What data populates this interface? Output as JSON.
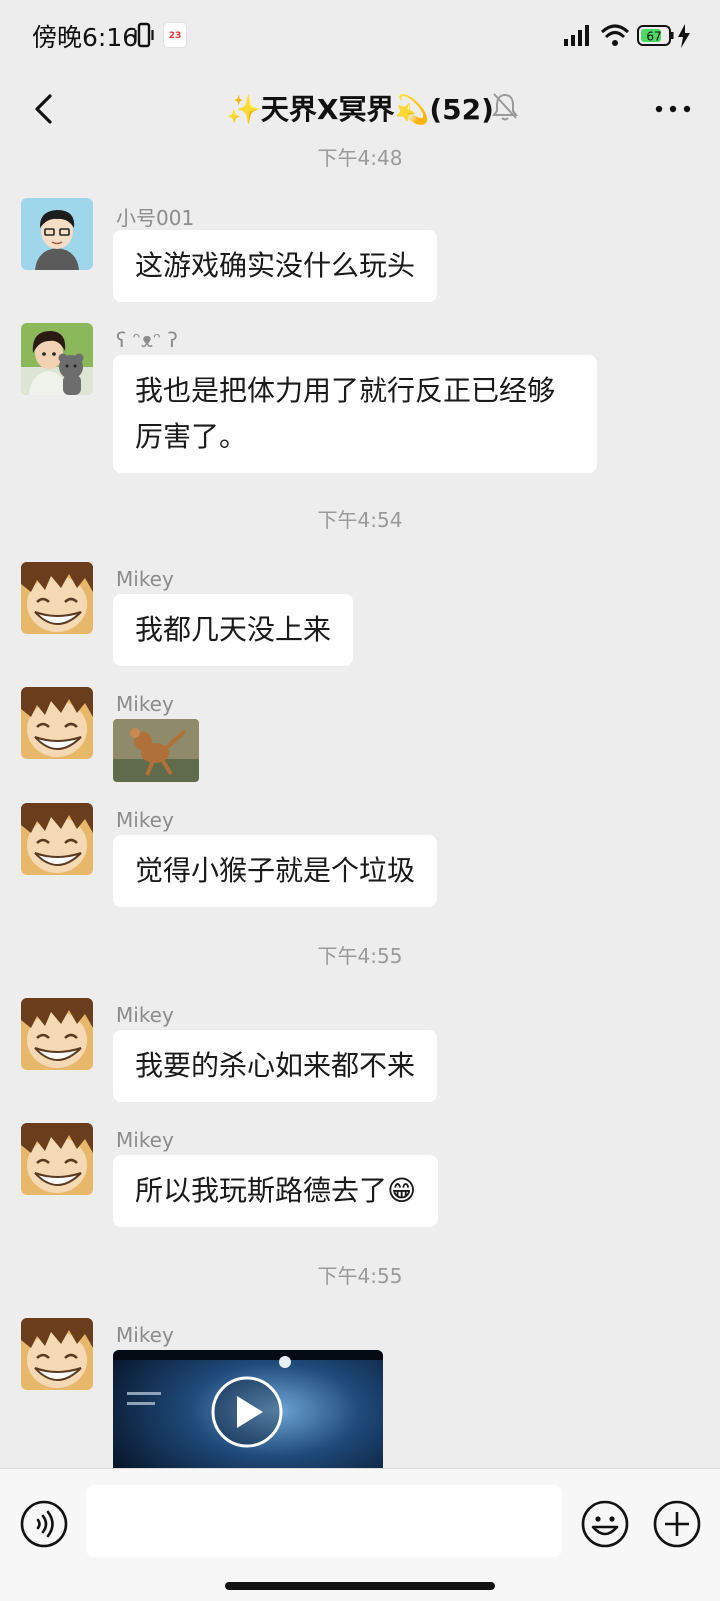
{
  "status_bar": {
    "time": "傍晚6:16",
    "calendar_date": "23",
    "battery": "67"
  },
  "header": {
    "title": "✨天界X冥界💫(52)",
    "back_icon": "chevron-left-icon",
    "mute_icon": "bell-muted-icon",
    "more_icon": "more-dots-icon"
  },
  "messages": [
    {
      "type": "time",
      "text": "下午4:48"
    },
    {
      "type": "text",
      "sender": "小号001",
      "text": "这游戏确实没什么玩头"
    },
    {
      "type": "text",
      "sender": "ʕ ᵔᴥᵔ ʔ",
      "text": "我也是把体力用了就行反正已经够厉害了。"
    },
    {
      "type": "time",
      "text": "下午4:54"
    },
    {
      "type": "text",
      "sender": "Mikey",
      "text": "我都几天没上来"
    },
    {
      "type": "image",
      "sender": "Mikey"
    },
    {
      "type": "text",
      "sender": "Mikey",
      "text": "觉得小猴子就是个垃圾"
    },
    {
      "type": "time",
      "text": "下午4:55"
    },
    {
      "type": "text",
      "sender": "Mikey",
      "text": "我要的杀心如来都不来"
    },
    {
      "type": "text",
      "sender": "Mikey",
      "text": "所以我玩斯路德去了😁"
    },
    {
      "type": "time",
      "text": "下午4:55"
    },
    {
      "type": "video",
      "sender": "Mikey"
    }
  ],
  "input_bar": {
    "voice_icon": "voice-icon",
    "text_value": "",
    "emoji_icon": "emoji-icon",
    "plus_icon": "plus-icon"
  },
  "colors": {
    "background": "#ededed",
    "bubble": "#ffffff",
    "battery_fill": "#4cd964"
  }
}
